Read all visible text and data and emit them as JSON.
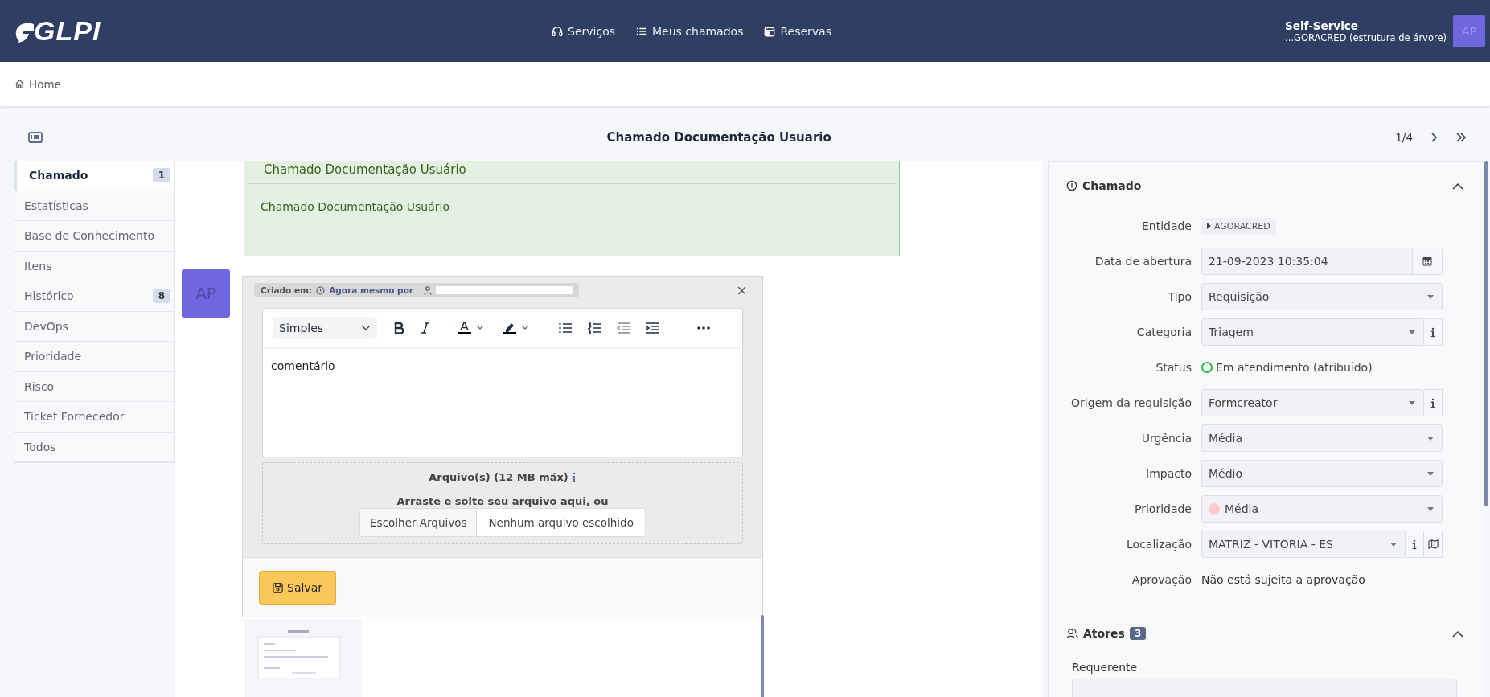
{
  "header": {
    "logo": "GLPI",
    "nav": [
      {
        "label": "Serviços"
      },
      {
        "label": "Meus chamados"
      },
      {
        "label": "Reservas"
      }
    ],
    "profile": "Self-Service",
    "entity": "...GORACRED (estrutura de árvore)",
    "avatar": "AP"
  },
  "breadcrumb": "Home",
  "title_bar": {
    "title": "Chamado Documentação Usuario",
    "pager": "1/4"
  },
  "tabs": [
    {
      "label": "Chamado",
      "count": "1",
      "selected": true
    },
    {
      "label": "Estatísticas",
      "selected": false
    },
    {
      "label": "Base de Conhecimento",
      "selected": false
    },
    {
      "label": "Itens",
      "selected": false
    },
    {
      "label": "Histórico",
      "count": "8",
      "selected": false
    },
    {
      "label": "DevOps",
      "selected": false
    },
    {
      "label": "Prioridade",
      "selected": false
    },
    {
      "label": "Risco",
      "selected": false
    },
    {
      "label": "Ticket Fornecedor",
      "selected": false
    },
    {
      "label": "Todos",
      "selected": false
    }
  ],
  "timeline": {
    "ticket_title": "Chamado Documentação Usuário",
    "ticket_body": "Chamado Documentação Usuário",
    "followup": {
      "avatar": "AP",
      "created_label": "Criado em:",
      "created_when": "Agora mesmo por",
      "editor": {
        "format": "Simples",
        "content": "comentário"
      },
      "files_label": "Arquivo(s) (12 MB máx)",
      "drop_hint": "Arraste e solte seu arquivo aqui, ou",
      "choose_button": "Escolher Arquivos",
      "no_file": "Nenhum arquivo escolhido",
      "save_button": "Salvar"
    }
  },
  "details": {
    "title": "Chamado",
    "fields": [
      {
        "label": "Entidade",
        "kind": "tag",
        "value": "AGORACRED"
      },
      {
        "label": "Data de abertura",
        "kind": "date",
        "value": "21-09-2023 10:35:04"
      },
      {
        "label": "Tipo",
        "kind": "select",
        "value": "Requisição"
      },
      {
        "label": "Categoria",
        "kind": "select",
        "value": "Triagem",
        "info": true
      },
      {
        "label": "Status",
        "kind": "status",
        "value": "Em atendimento (atribuído)",
        "color": "#2fb344"
      },
      {
        "label": "Origem da requisição",
        "kind": "select",
        "value": "Formcreator",
        "info": true
      },
      {
        "label": "Urgência",
        "kind": "select",
        "value": "Média"
      },
      {
        "label": "Impacto",
        "kind": "select",
        "value": "Médio"
      },
      {
        "label": "Prioridade",
        "kind": "select",
        "value": "Média",
        "color": "#ffcccc"
      },
      {
        "label": "Localização",
        "kind": "select",
        "value": "MATRIZ - VITORIA - ES",
        "info": true,
        "map": true
      },
      {
        "label": "Aprovação",
        "kind": "text",
        "value": "Não está sujeita a aprovação"
      }
    ]
  },
  "actors": {
    "title": "Atores",
    "count": "3",
    "requester_label": "Requerente"
  }
}
